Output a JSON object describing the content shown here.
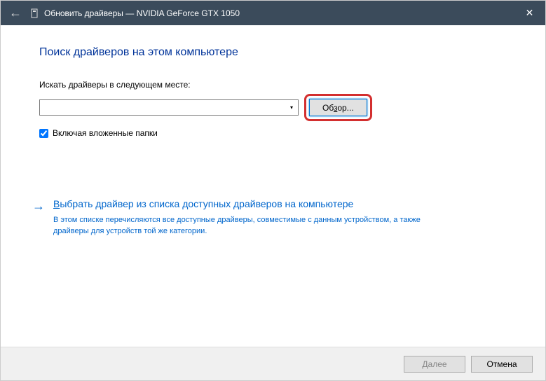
{
  "titlebar": {
    "title": "Обновить драйверы — NVIDIA GeForce GTX 1050"
  },
  "content": {
    "heading": "Поиск драйверов на этом компьютере",
    "search_label": "Искать драйверы в следующем месте:",
    "path_value": "",
    "browse_label": "Обзор...",
    "include_subfolders_label": "Включая вложенные папки",
    "include_subfolders_checked": true
  },
  "option": {
    "title_prefix": "В",
    "title_rest": "ыбрать драйвер из списка доступных драйверов на компьютере",
    "description": "В этом списке перечисляются все доступные драйверы, совместимые с данным устройством, а также драйверы для устройств той же категории."
  },
  "footer": {
    "next_label": "Далее",
    "cancel_label": "Отмена"
  }
}
